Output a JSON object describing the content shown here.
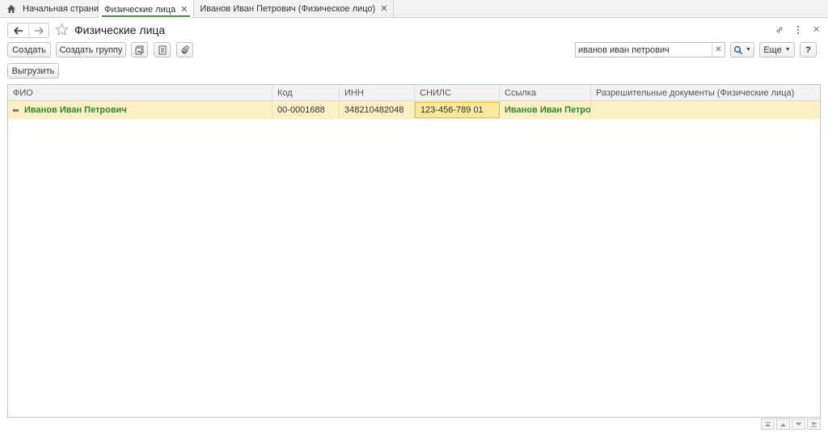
{
  "tabs": [
    {
      "label": "Начальная страница",
      "icon": "home-icon"
    },
    {
      "label": "Физические лица",
      "active": true
    },
    {
      "label": "Иванов Иван Петрович (Физическое лицо)"
    }
  ],
  "header": {
    "title": "Физические лица"
  },
  "toolbar": {
    "create_label": "Создать",
    "create_group_label": "Создать группу",
    "more_label": "Еще",
    "help_label": "?",
    "export_label": "Выгрузить"
  },
  "search": {
    "value": "иванов иван петрович"
  },
  "table": {
    "columns": [
      "ФИО",
      "Код",
      "ИНН",
      "СНИЛС",
      "Ссылка",
      "Разрешительные документы (Физические лица)"
    ],
    "rows": [
      {
        "fio": "Иванов Иван Петрович",
        "code": "00-0001688",
        "inn": "348210482048",
        "snils": "123-456-789 01",
        "link": "Иванов Иван Петрович",
        "permits": ""
      }
    ]
  },
  "colors": {
    "accent_green": "#2b8a2b",
    "row_highlight": "#fdf0c4",
    "focus_cell": "#fde79a"
  }
}
